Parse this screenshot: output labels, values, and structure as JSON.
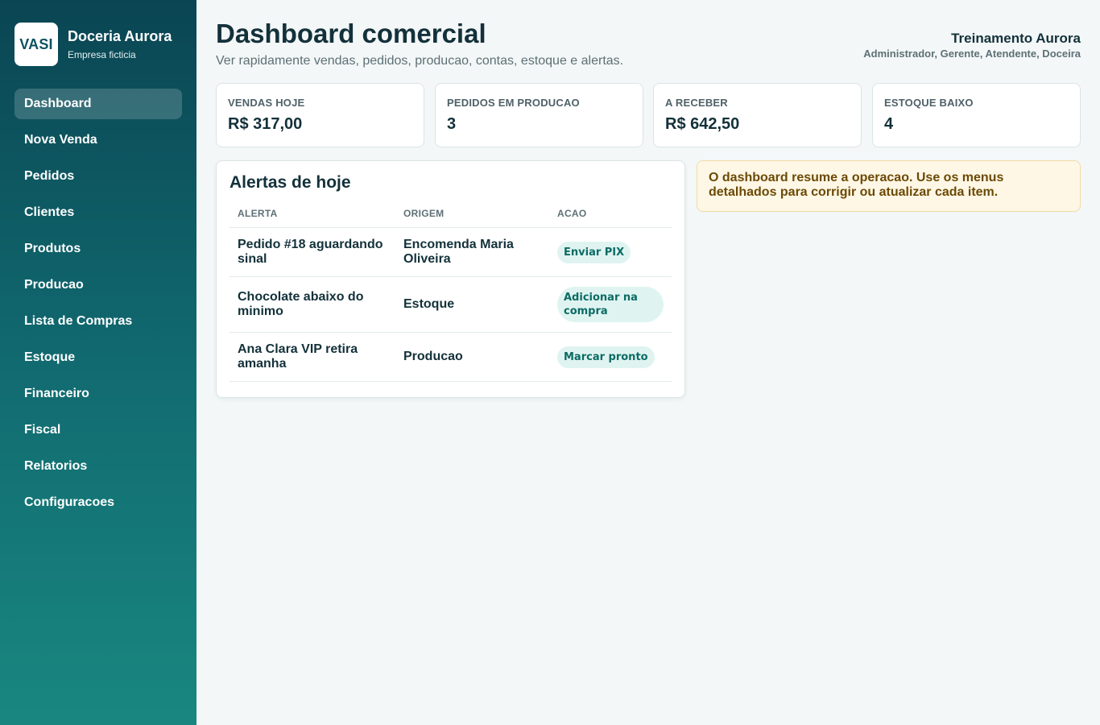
{
  "brand": {
    "logo_text": "VASI",
    "name": "Doceria Aurora",
    "subtitle": "Empresa ficticia"
  },
  "nav": {
    "items": [
      {
        "label": "Dashboard",
        "active": true
      },
      {
        "label": "Nova Venda",
        "active": false
      },
      {
        "label": "Pedidos",
        "active": false
      },
      {
        "label": "Clientes",
        "active": false
      },
      {
        "label": "Produtos",
        "active": false
      },
      {
        "label": "Producao",
        "active": false
      },
      {
        "label": "Lista de Compras",
        "active": false
      },
      {
        "label": "Estoque",
        "active": false
      },
      {
        "label": "Financeiro",
        "active": false
      },
      {
        "label": "Fiscal",
        "active": false
      },
      {
        "label": "Relatorios",
        "active": false
      },
      {
        "label": "Configuracoes",
        "active": false
      }
    ]
  },
  "header": {
    "title": "Dashboard comercial",
    "subtitle": "Ver rapidamente vendas, pedidos, producao, contas, estoque e alertas.",
    "user_name": "Treinamento Aurora",
    "user_roles": "Administrador, Gerente, Atendente, Doceira"
  },
  "kpis": [
    {
      "label": "VENDAS HOJE",
      "value": "R$ 317,00"
    },
    {
      "label": "PEDIDOS EM PRODUCAO",
      "value": "3"
    },
    {
      "label": "A RECEBER",
      "value": "R$ 642,50"
    },
    {
      "label": "ESTOQUE BAIXO",
      "value": "4"
    }
  ],
  "alerts": {
    "title": "Alertas de hoje",
    "columns": [
      "ALERTA",
      "ORIGEM",
      "ACAO"
    ],
    "rows": [
      {
        "alert": "Pedido #18 aguardando sinal",
        "origin": "Encomenda Maria Oliveira",
        "action": "Enviar PIX"
      },
      {
        "alert": "Chocolate abaixo do minimo",
        "origin": "Estoque",
        "action": "Adicionar na compra"
      },
      {
        "alert": "Ana Clara VIP retira amanha",
        "origin": "Producao",
        "action": "Marcar pronto"
      }
    ]
  },
  "notice": {
    "text": "O dashboard resume a operacao. Use os menus detalhados para corrigir ou atualizar cada item."
  },
  "colors": {
    "sidebar_top": "#0a4553",
    "sidebar_bottom": "#198780",
    "accent_pill_bg": "#dff4f1",
    "accent_pill_text": "#0c6b64",
    "notice_bg": "#fff7e6"
  }
}
